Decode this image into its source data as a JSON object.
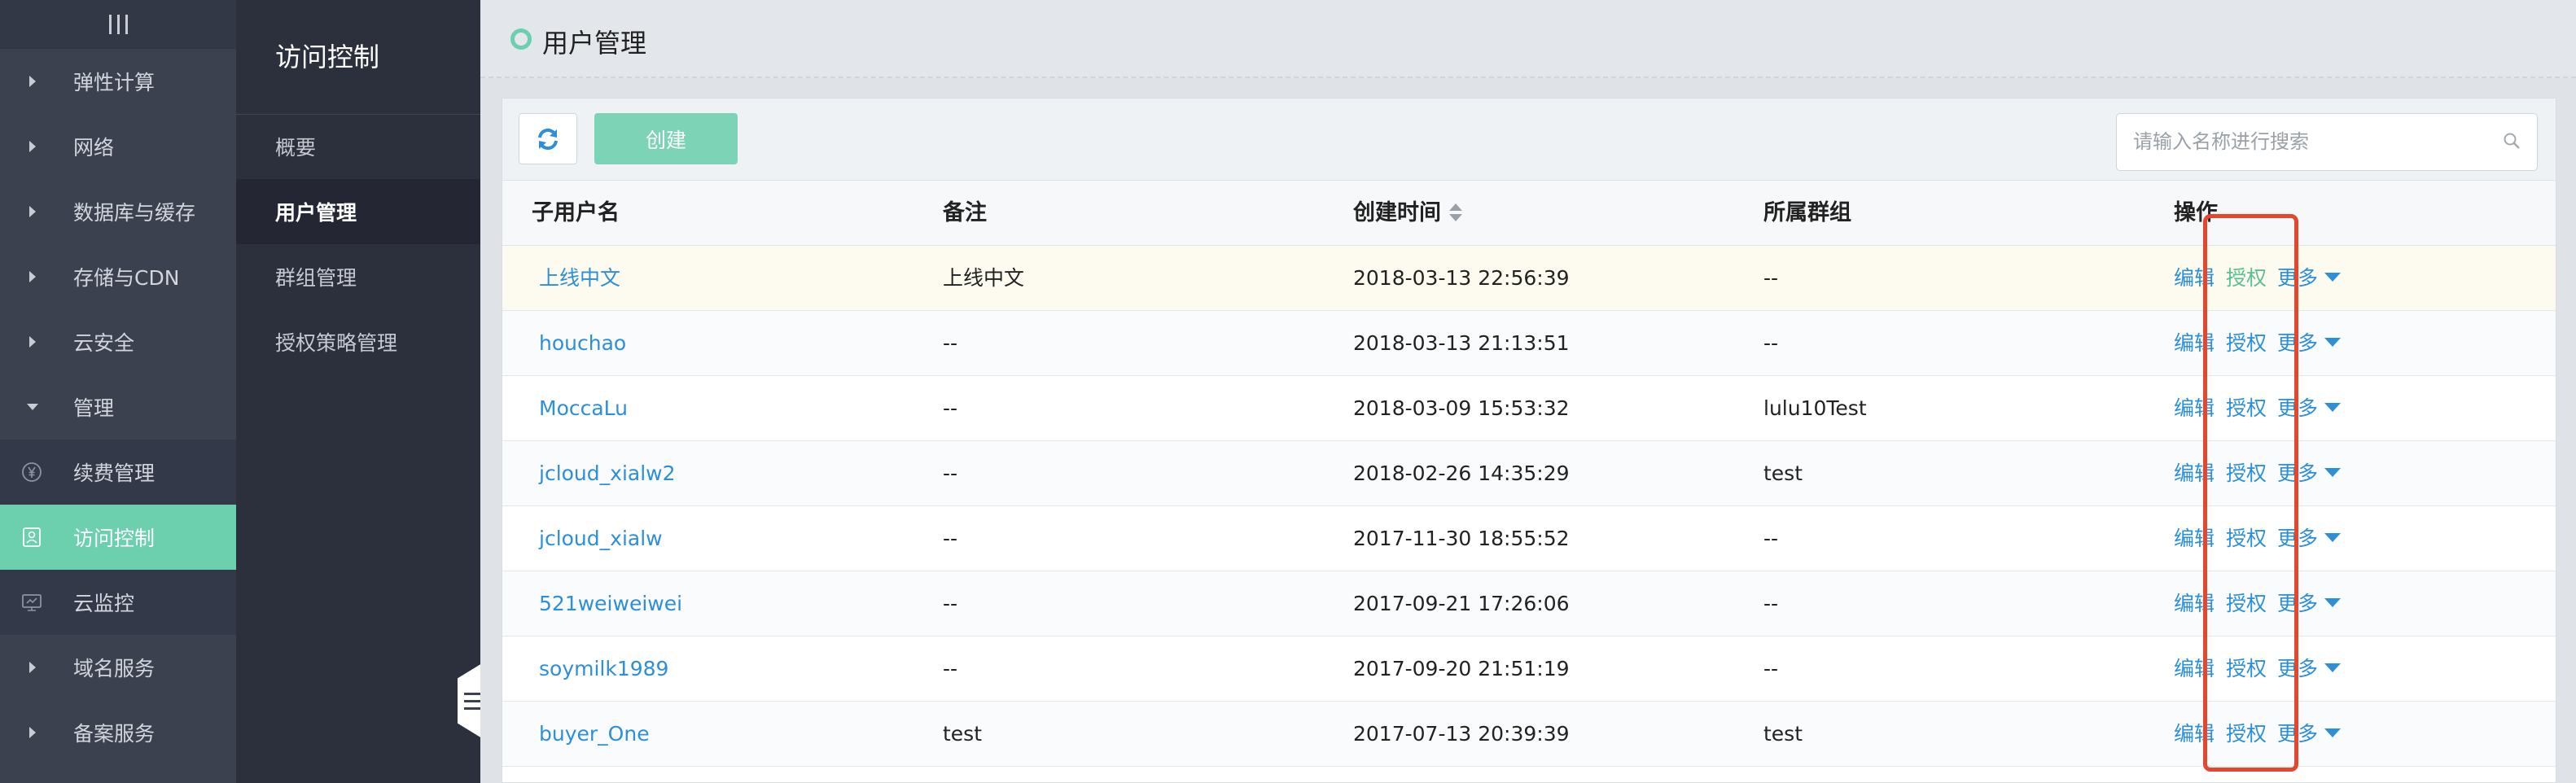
{
  "nav": {
    "items": [
      {
        "label": "弹性计算",
        "icon": "arrow-right-icon"
      },
      {
        "label": "网络",
        "icon": "arrow-right-icon"
      },
      {
        "label": "数据库与缓存",
        "icon": "arrow-right-icon"
      },
      {
        "label": "存储与CDN",
        "icon": "arrow-right-icon"
      },
      {
        "label": "云安全",
        "icon": "arrow-right-icon"
      },
      {
        "label": "管理",
        "icon": "arrow-down-icon"
      },
      {
        "label": "续费管理",
        "icon": "yen-icon"
      },
      {
        "label": "访问控制",
        "icon": "user-card-icon",
        "active": true
      },
      {
        "label": "云监控",
        "icon": "monitor-icon"
      },
      {
        "label": "域名服务",
        "icon": "arrow-right-icon"
      },
      {
        "label": "备案服务",
        "icon": "arrow-right-icon"
      }
    ]
  },
  "subnav": {
    "title": "访问控制",
    "items": [
      {
        "label": "概要"
      },
      {
        "label": "用户管理",
        "active": true
      },
      {
        "label": "群组管理"
      },
      {
        "label": "授权策略管理"
      }
    ]
  },
  "page": {
    "title": "用户管理"
  },
  "toolbar": {
    "refresh_icon": "refresh-icon",
    "create_label": "创建",
    "search_placeholder": "请输入名称进行搜索",
    "search_value": ""
  },
  "table": {
    "headers": {
      "username": "子用户名",
      "remark": "备注",
      "created": "创建时间",
      "group": "所属群组",
      "ops": "操作"
    },
    "op_labels": {
      "edit": "编辑",
      "auth": "授权",
      "more": "更多"
    },
    "rows": [
      {
        "username": "上线中文",
        "remark": "上线中文",
        "created": "2018-03-13 22:56:39",
        "group": "--"
      },
      {
        "username": "houchao",
        "remark": "--",
        "created": "2018-03-13 21:13:51",
        "group": "--"
      },
      {
        "username": "MoccaLu",
        "remark": "--",
        "created": "2018-03-09 15:53:32",
        "group": "lulu10Test"
      },
      {
        "username": "jcloud_xialw2",
        "remark": "--",
        "created": "2018-02-26 14:35:29",
        "group": "test"
      },
      {
        "username": "jcloud_xialw",
        "remark": "--",
        "created": "2017-11-30 18:55:52",
        "group": "--"
      },
      {
        "username": "521weiweiwei",
        "remark": "--",
        "created": "2017-09-21 17:26:06",
        "group": "--"
      },
      {
        "username": "soymilk1989",
        "remark": "--",
        "created": "2017-09-20 21:51:19",
        "group": "--"
      },
      {
        "username": "buyer_One",
        "remark": "test",
        "created": "2017-07-13 20:39:39",
        "group": "test"
      }
    ]
  },
  "colors": {
    "accent": "#6ccfae",
    "link": "#2d8fd8",
    "annotation": "#e4472c"
  }
}
